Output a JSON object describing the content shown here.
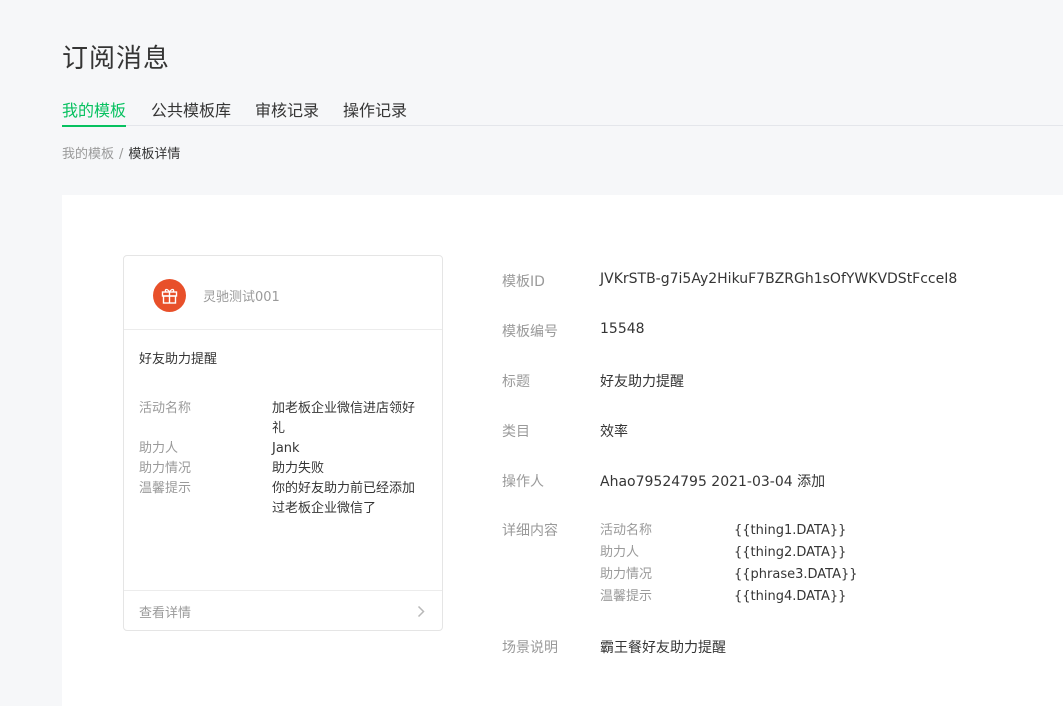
{
  "page_title": "订阅消息",
  "tabs": [
    {
      "label": "我的模板",
      "active": true
    },
    {
      "label": "公共模板库",
      "active": false
    },
    {
      "label": "审核记录",
      "active": false
    },
    {
      "label": "操作记录",
      "active": false
    }
  ],
  "breadcrumb": {
    "parent": "我的模板",
    "separator": "/",
    "current": "模板详情"
  },
  "preview_card": {
    "account_name": "灵驰测试001",
    "logo_icon": "gift-icon",
    "title": "好友助力提醒",
    "fields": [
      {
        "key": "活动名称",
        "value": "加老板企业微信进店领好礼"
      },
      {
        "key": "助力人",
        "value": "Jank"
      },
      {
        "key": "助力情况",
        "value": "助力失败"
      },
      {
        "key": "温馨提示",
        "value": "你的好友助力前已经添加过老板企业微信了"
      }
    ],
    "view_detail": "查看详情"
  },
  "info": {
    "template_id_label": "模板ID",
    "template_id": "JVKrSTB-g7i5Ay2HikuF7BZRGh1sOfYWKVDStFcceI8",
    "template_no_label": "模板编号",
    "template_no": "15548",
    "title_label": "标题",
    "title": "好友助力提醒",
    "category_label": "类目",
    "category": "效率",
    "operator_label": "操作人",
    "operator": "Ahao79524795 2021-03-04 添加",
    "detail_label": "详细内容",
    "details": [
      {
        "key": "活动名称",
        "value": "{{thing1.DATA}}"
      },
      {
        "key": "助力人",
        "value": "{{thing2.DATA}}"
      },
      {
        "key": "助力情况",
        "value": "{{phrase3.DATA}}"
      },
      {
        "key": "温馨提示",
        "value": "{{thing4.DATA}}"
      }
    ],
    "scene_label": "场景说明",
    "scene": "霸王餐好友助力提醒"
  },
  "colors": {
    "accent": "#07c160",
    "logo_bg": "#e8502a",
    "muted_text": "#9a9a9a"
  }
}
